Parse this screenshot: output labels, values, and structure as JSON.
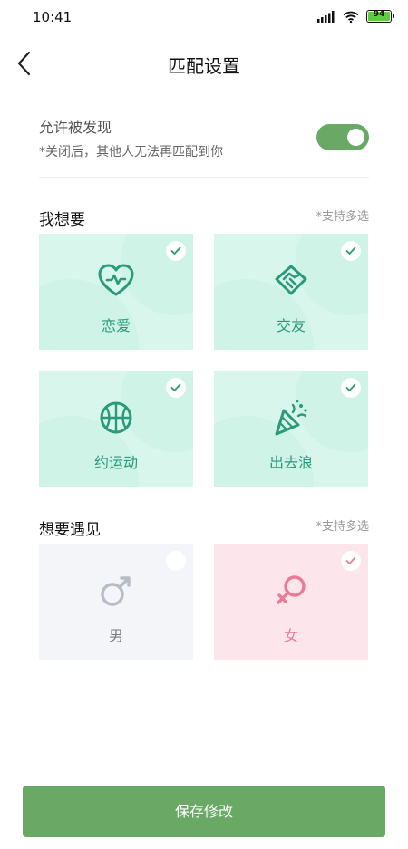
{
  "status_bar": {
    "time": "10:41",
    "battery": "94"
  },
  "header": {
    "title": "匹配设置"
  },
  "discover": {
    "title": "允许被发现",
    "subtitle": "*关闭后，其他人无法再匹配到你",
    "enabled": true
  },
  "want": {
    "title": "我想要",
    "hint": "*支持多选",
    "options": [
      {
        "label": "恋爱",
        "icon": "heart-icon",
        "selected": true
      },
      {
        "label": "交友",
        "icon": "handshake-icon",
        "selected": true
      },
      {
        "label": "约运动",
        "icon": "basketball-icon",
        "selected": true
      },
      {
        "label": "出去浪",
        "icon": "party-popper-icon",
        "selected": true
      }
    ]
  },
  "meet": {
    "title": "想要遇见",
    "hint": "*支持多选",
    "options": [
      {
        "label": "男",
        "icon": "male-icon",
        "selected": false
      },
      {
        "label": "女",
        "icon": "female-icon",
        "selected": true
      }
    ]
  },
  "save_label": "保存修改",
  "colors": {
    "accent": "#69a965",
    "mint": "#2b9a7a",
    "pink": "#e97b99"
  }
}
